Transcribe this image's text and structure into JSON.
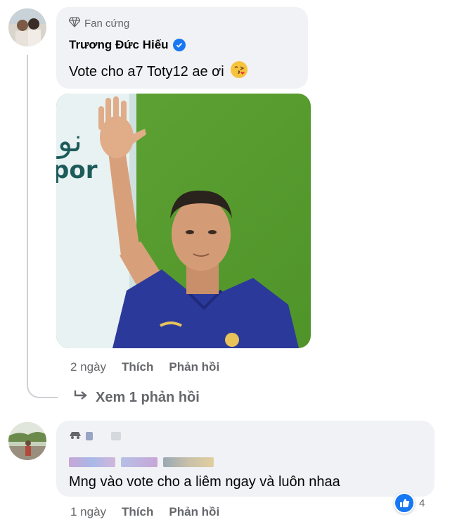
{
  "comment1": {
    "badge_label": "Fan cứng",
    "author": "Trương Đức Hiếu",
    "text": "Vote cho a7 Toty12 ae ơi",
    "emoji": "😘",
    "time": "2 ngày",
    "like_label": "Thích",
    "reply_label": "Phản hồi",
    "see_replies": "Xem 1 phản hồi"
  },
  "comment2": {
    "text": "Mng vào vote cho a liêm ngay và luôn nhaa",
    "time": "1 ngày",
    "like_label": "Thích",
    "reply_label": "Phản hồi",
    "reaction_count": "4"
  },
  "colors": {
    "bubble": "#f0f2f5",
    "secondary_text": "#65676b",
    "accent": "#1877f2"
  },
  "icons": [
    "diamond-icon",
    "verified-icon",
    "reply-arrow-icon",
    "like-icon"
  ]
}
